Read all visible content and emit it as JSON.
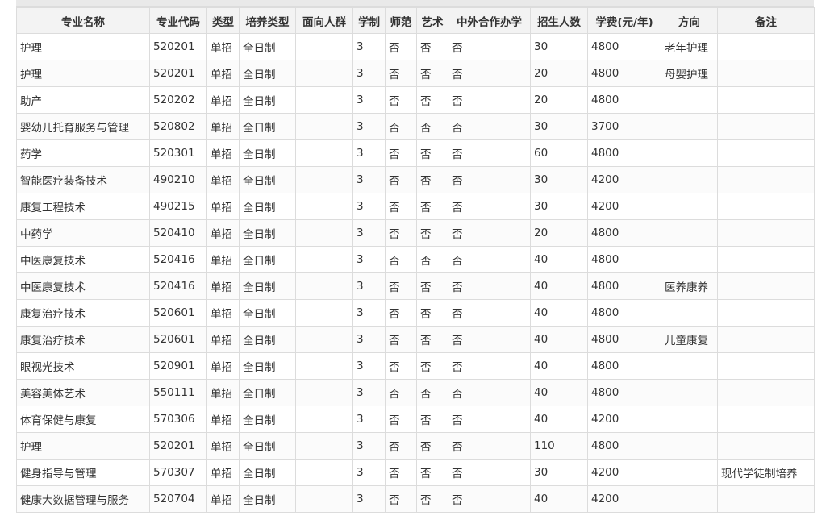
{
  "table": {
    "headers": [
      "专业名称",
      "专业代码",
      "类型",
      "培养类型",
      "面向人群",
      "学制",
      "师范",
      "艺术",
      "中外合作办学",
      "招生人数",
      "学费(元/年)",
      "方向",
      "备注"
    ],
    "rows": [
      [
        "护理",
        "520201",
        "单招",
        "全日制",
        "",
        "3",
        "否",
        "否",
        "否",
        "30",
        "4800",
        "老年护理",
        ""
      ],
      [
        "护理",
        "520201",
        "单招",
        "全日制",
        "",
        "3",
        "否",
        "否",
        "否",
        "20",
        "4800",
        "母婴护理",
        ""
      ],
      [
        "助产",
        "520202",
        "单招",
        "全日制",
        "",
        "3",
        "否",
        "否",
        "否",
        "20",
        "4800",
        "",
        ""
      ],
      [
        "婴幼儿托育服务与管理",
        "520802",
        "单招",
        "全日制",
        "",
        "3",
        "否",
        "否",
        "否",
        "30",
        "3700",
        "",
        ""
      ],
      [
        "药学",
        "520301",
        "单招",
        "全日制",
        "",
        "3",
        "否",
        "否",
        "否",
        "60",
        "4800",
        "",
        ""
      ],
      [
        "智能医疗装备技术",
        "490210",
        "单招",
        "全日制",
        "",
        "3",
        "否",
        "否",
        "否",
        "30",
        "4200",
        "",
        ""
      ],
      [
        "康复工程技术",
        "490215",
        "单招",
        "全日制",
        "",
        "3",
        "否",
        "否",
        "否",
        "30",
        "4200",
        "",
        ""
      ],
      [
        "中药学",
        "520410",
        "单招",
        "全日制",
        "",
        "3",
        "否",
        "否",
        "否",
        "20",
        "4800",
        "",
        ""
      ],
      [
        "中医康复技术",
        "520416",
        "单招",
        "全日制",
        "",
        "3",
        "否",
        "否",
        "否",
        "40",
        "4800",
        "",
        ""
      ],
      [
        "中医康复技术",
        "520416",
        "单招",
        "全日制",
        "",
        "3",
        "否",
        "否",
        "否",
        "40",
        "4800",
        "医养康养",
        ""
      ],
      [
        "康复治疗技术",
        "520601",
        "单招",
        "全日制",
        "",
        "3",
        "否",
        "否",
        "否",
        "40",
        "4800",
        "",
        ""
      ],
      [
        "康复治疗技术",
        "520601",
        "单招",
        "全日制",
        "",
        "3",
        "否",
        "否",
        "否",
        "40",
        "4800",
        "儿童康复",
        ""
      ],
      [
        "眼视光技术",
        "520901",
        "单招",
        "全日制",
        "",
        "3",
        "否",
        "否",
        "否",
        "40",
        "4800",
        "",
        ""
      ],
      [
        "美容美体艺术",
        "550111",
        "单招",
        "全日制",
        "",
        "3",
        "否",
        "否",
        "否",
        "40",
        "4800",
        "",
        ""
      ],
      [
        "体育保健与康复",
        "570306",
        "单招",
        "全日制",
        "",
        "3",
        "否",
        "否",
        "否",
        "40",
        "4200",
        "",
        ""
      ],
      [
        "护理",
        "520201",
        "单招",
        "全日制",
        "",
        "3",
        "否",
        "否",
        "否",
        "110",
        "4800",
        "",
        ""
      ],
      [
        "健身指导与管理",
        "570307",
        "单招",
        "全日制",
        "",
        "3",
        "否",
        "否",
        "否",
        "30",
        "4200",
        "",
        "现代学徒制培养"
      ],
      [
        "健康大数据管理与服务",
        "520704",
        "单招",
        "全日制",
        "",
        "3",
        "否",
        "否",
        "否",
        "40",
        "4200",
        "",
        ""
      ]
    ]
  }
}
